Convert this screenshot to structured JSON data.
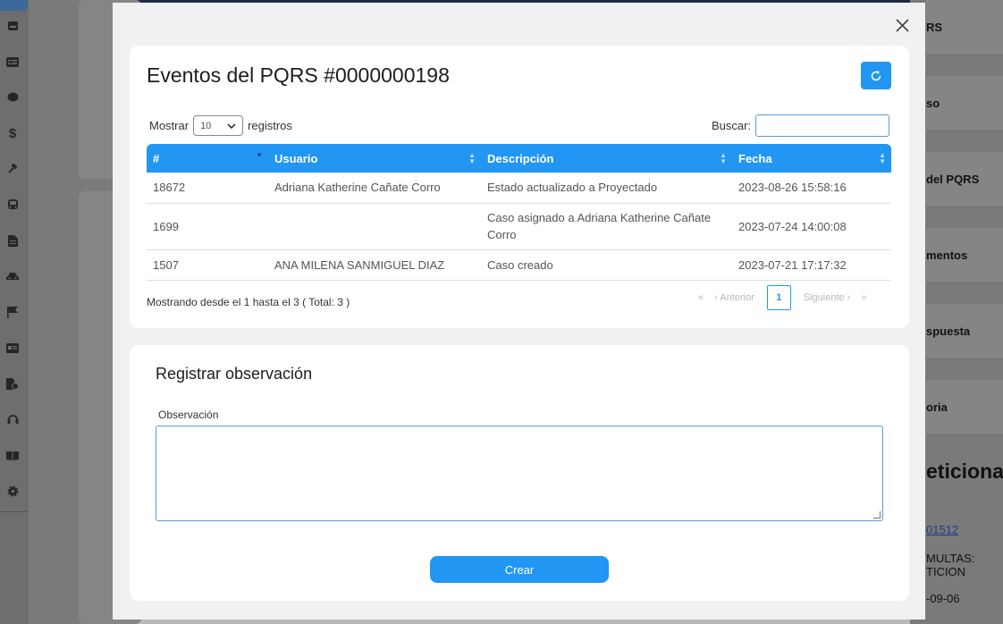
{
  "background": {
    "right_panels": [
      "RS",
      "so",
      "del PQRS",
      "mentos",
      "spuesta",
      "oria"
    ],
    "right_heading": "eticiona",
    "right_link": "01512",
    "right_text_lines": [
      "MULTAS:",
      "TICION",
      "-09-06"
    ]
  },
  "sidebar_icons": [
    "inbox-icon",
    "card-list-icon",
    "chat-icon",
    "dollar-icon",
    "gavel-icon",
    "bus-icon",
    "document-icon",
    "car-icon",
    "flag-icon",
    "id-card-icon",
    "file-info-icon",
    "headset-icon",
    "book-icon",
    "gear-icon"
  ],
  "modal": {
    "title": "Eventos del PQRS #0000000198",
    "length_prefix": "Mostrar",
    "length_value": "10",
    "length_suffix": "registros",
    "search_label": "Buscar:",
    "columns": [
      "#",
      "Usuario",
      "Descripción",
      "Fecha"
    ],
    "rows": [
      {
        "id": "18672",
        "usuario": "Adriana Katherine Cañate Corro",
        "descripcion": "Estado actualizado a Proyectado",
        "fecha": "2023-08-26 15:58:16"
      },
      {
        "id": "1699",
        "usuario": "",
        "descripcion": "Caso asignado a Adriana Katherine Cañate Corro",
        "fecha": "2023-07-24 14:00:08"
      },
      {
        "id": "1507",
        "usuario": "ANA MILENA SANMIGUEL DIAZ",
        "descripcion": "Caso creado",
        "fecha": "2023-07-21 17:17:32"
      }
    ],
    "info": "Mostrando desde el 1 hasta el 3 ( Total: 3 )",
    "pager": {
      "prev": "Anterior",
      "current": "1",
      "next": "Siguiente"
    }
  },
  "observation": {
    "title": "Registrar observación",
    "label": "Observación",
    "value": "",
    "submit": "Crear"
  },
  "colors": {
    "accent": "#2196f3",
    "header_text": "#ffffff"
  }
}
